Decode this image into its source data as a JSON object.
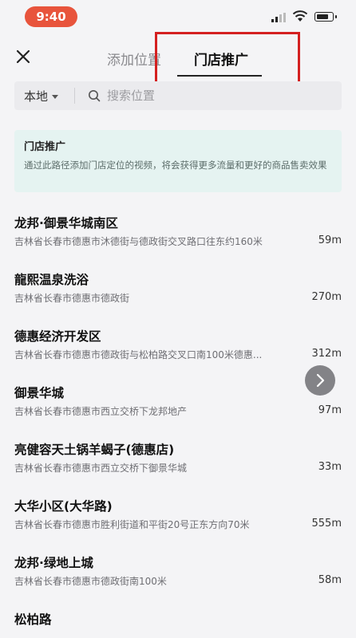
{
  "status_bar": {
    "time": "9:40"
  },
  "header": {
    "tabs": [
      {
        "label": "添加位置"
      },
      {
        "label": "门店推广"
      }
    ]
  },
  "search": {
    "region_label": "本地",
    "placeholder": "搜索位置"
  },
  "banner": {
    "title": "门店推广",
    "text": "通过此路径添加门店定位的视频，将会获得更多流量和更好的商品售卖效果"
  },
  "places": [
    {
      "name": "龙邦·御景华城南区",
      "address": "吉林省长春市德惠市沐德街与德政街交叉路口往东约160米",
      "distance": "59m"
    },
    {
      "name": "龍熙温泉洗浴",
      "address": "吉林省长春市德惠市德政街",
      "distance": "270m"
    },
    {
      "name": "德惠经济开发区",
      "address": "吉林省长春市德惠市德政街与松柏路交叉口南100米德惠...",
      "distance": "312m"
    },
    {
      "name": "御景华城",
      "address": "吉林省长春市德惠市西立交桥下龙邦地产",
      "distance": "97m"
    },
    {
      "name": "亮健容天土锅羊蝎子(德惠店)",
      "address": "吉林省长春市德惠市西立交桥下御景华城",
      "distance": "33m"
    },
    {
      "name": "大华小区(大华路)",
      "address": "吉林省长春市德惠市胜利街道和平街20号正东方向70米",
      "distance": "555m"
    },
    {
      "name": "龙邦·绿地上城",
      "address": "吉林省长春市德惠市德政街南100米",
      "distance": "58m"
    },
    {
      "name": "松柏路",
      "address": "",
      "distance": ""
    }
  ]
}
